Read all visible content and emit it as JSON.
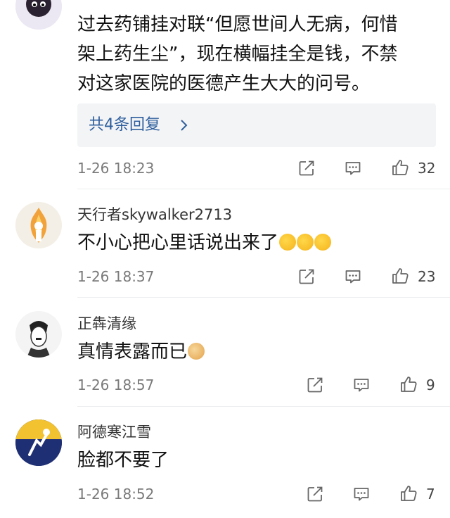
{
  "comments": [
    {
      "username": "",
      "text_line1": "过去药铺挂对联“但愿世间人无病，何惜",
      "text_line2": "架上药生尘”，现在横幅挂全是钱，不禁",
      "text_line3": "对这家医院的医德产生大大的问号。",
      "replies_label": "共4条回复",
      "time": "1-26 18:23",
      "likes": "32"
    },
    {
      "username": "天行者skywalker2713",
      "text": "不小心把心里话说出来了",
      "time": "1-26 18:37",
      "likes": "23"
    },
    {
      "username": "正犇清缘",
      "text": "真情表露而已",
      "time": "1-26 18:57",
      "likes": "9"
    },
    {
      "username": "阿德寒江雪",
      "text": "脸都不要了",
      "time": "1-26 18:52",
      "likes": "7"
    }
  ],
  "icons": {
    "share": "share-icon",
    "comment": "comment-icon",
    "like": "like-icon"
  },
  "colors": {
    "link": "#2f5f9e",
    "meta": "#7a7a7a",
    "reply_bg": "#f3f4f6"
  }
}
